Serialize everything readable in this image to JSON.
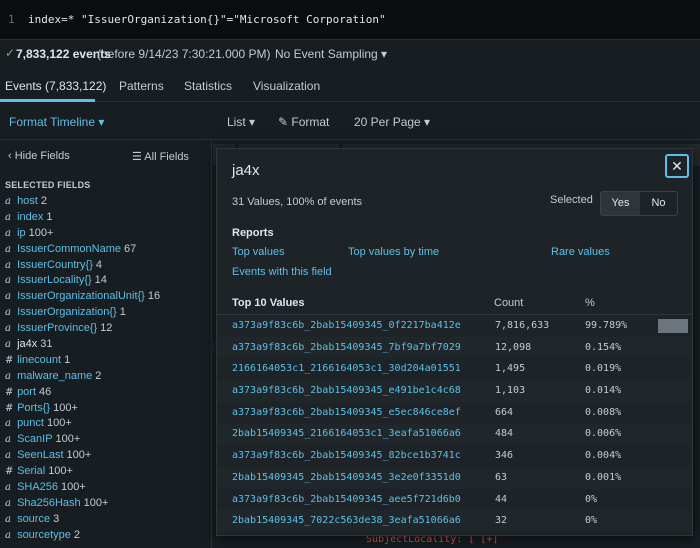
{
  "query": {
    "line_number": "1",
    "text": "index=* \"IssuerOrganization{}\"=\"Microsoft Corporation\""
  },
  "status": {
    "check": "✓",
    "count": "7,833,122 events",
    "before": "(before 9/14/23 7:30:21.000 PM)",
    "sampling": "No Event Sampling ▾"
  },
  "tabs": [
    {
      "label": "Events (7,833,122)",
      "active": true
    },
    {
      "label": "Patterns",
      "active": false
    },
    {
      "label": "Statistics",
      "active": false
    },
    {
      "label": "Visualization",
      "active": false
    }
  ],
  "toolbar": {
    "format_timeline": "Format Timeline ▾",
    "list": "List ▾",
    "format": "✎ Format",
    "per_page": "20 Per Page ▾"
  },
  "sidebar": {
    "hide_fields": "‹ Hide Fields",
    "all_fields": "☰ All Fields",
    "selected_heading": "SELECTED FIELDS",
    "fields": [
      {
        "type": "a",
        "name": "host",
        "count": "2"
      },
      {
        "type": "a",
        "name": "index",
        "count": "1"
      },
      {
        "type": "a",
        "name": "ip",
        "count": "100+"
      },
      {
        "type": "a",
        "name": "IssuerCommonName",
        "count": "67"
      },
      {
        "type": "a",
        "name": "IssuerCountry{}",
        "count": "4"
      },
      {
        "type": "a",
        "name": "IssuerLocality{}",
        "count": "14"
      },
      {
        "type": "a",
        "name": "IssuerOrganizationalUnit{}",
        "count": "16"
      },
      {
        "type": "a",
        "name": "IssuerOrganization{}",
        "count": "1"
      },
      {
        "type": "a",
        "name": "IssuerProvince{}",
        "count": "12"
      },
      {
        "type": "a",
        "name": "ja4x",
        "count": "31",
        "active": true
      },
      {
        "type": "#",
        "name": "linecount",
        "count": "1"
      },
      {
        "type": "a",
        "name": "malware_name",
        "count": "2"
      },
      {
        "type": "#",
        "name": "port",
        "count": "46"
      },
      {
        "type": "#",
        "name": "Ports{}",
        "count": "100+"
      },
      {
        "type": "a",
        "name": "punct",
        "count": "100+"
      },
      {
        "type": "a",
        "name": "ScanIP",
        "count": "100+"
      },
      {
        "type": "a",
        "name": "SeenLast",
        "count": "100+"
      },
      {
        "type": "#",
        "name": "Serial",
        "count": "100+"
      },
      {
        "type": "a",
        "name": "SHA256",
        "count": "100+"
      },
      {
        "type": "a",
        "name": "Sha256Hash",
        "count": "100+"
      },
      {
        "type": "a",
        "name": "source",
        "count": "3"
      },
      {
        "type": "a",
        "name": "sourcetype",
        "count": "2"
      }
    ]
  },
  "background": {
    "bottom_hint": "SubjectLocality: [ [+]"
  },
  "popover": {
    "title": "ja4x",
    "close": "✕",
    "summary": "31 Values, 100% of events",
    "selected_label": "Selected",
    "yes": "Yes",
    "no": "No",
    "reports_heading": "Reports",
    "report_links": [
      "Top values",
      "Top values by time",
      "Rare values",
      "Events with this field"
    ],
    "table_headers": {
      "value": "Top 10 Values",
      "count": "Count",
      "percent": "%"
    },
    "values": [
      {
        "value": "a373a9f83c6b_2bab15409345_0f2217ba412e",
        "count": "7,816,633",
        "percent": "99.789%",
        "fraction": 0.99789
      },
      {
        "value": "a373a9f83c6b_2bab15409345_7bf9a7bf7029",
        "count": "12,098",
        "percent": "0.154%",
        "fraction": 0.00154
      },
      {
        "value": "2166164053c1_2166164053c1_30d204a01551",
        "count": "1,495",
        "percent": "0.019%",
        "fraction": 0.00019
      },
      {
        "value": "a373a9f83c6b_2bab15409345_e491be1c4c68",
        "count": "1,103",
        "percent": "0.014%",
        "fraction": 0.00014
      },
      {
        "value": "a373a9f83c6b_2bab15409345_e5ec846ce8ef",
        "count": "664",
        "percent": "0.008%",
        "fraction": 8e-05
      },
      {
        "value": "2bab15409345_2166164053c1_3eafa51066a6",
        "count": "484",
        "percent": "0.006%",
        "fraction": 6e-05
      },
      {
        "value": "a373a9f83c6b_2bab15409345_82bce1b3741c",
        "count": "346",
        "percent": "0.004%",
        "fraction": 4e-05
      },
      {
        "value": "2bab15409345_2bab15409345_3e2e0f3351d0",
        "count": "63",
        "percent": "0.001%",
        "fraction": 1e-05
      },
      {
        "value": "a373a9f83c6b_2bab15409345_aee5f721d6b0",
        "count": "44",
        "percent": "0%",
        "fraction": 0
      },
      {
        "value": "2bab15409345_7022c563de38_3eafa51066a6",
        "count": "32",
        "percent": "0%",
        "fraction": 0
      }
    ]
  },
  "colors": {
    "accent": "#5cc0e8",
    "success": "#5cc05c",
    "background": "#171d21"
  }
}
